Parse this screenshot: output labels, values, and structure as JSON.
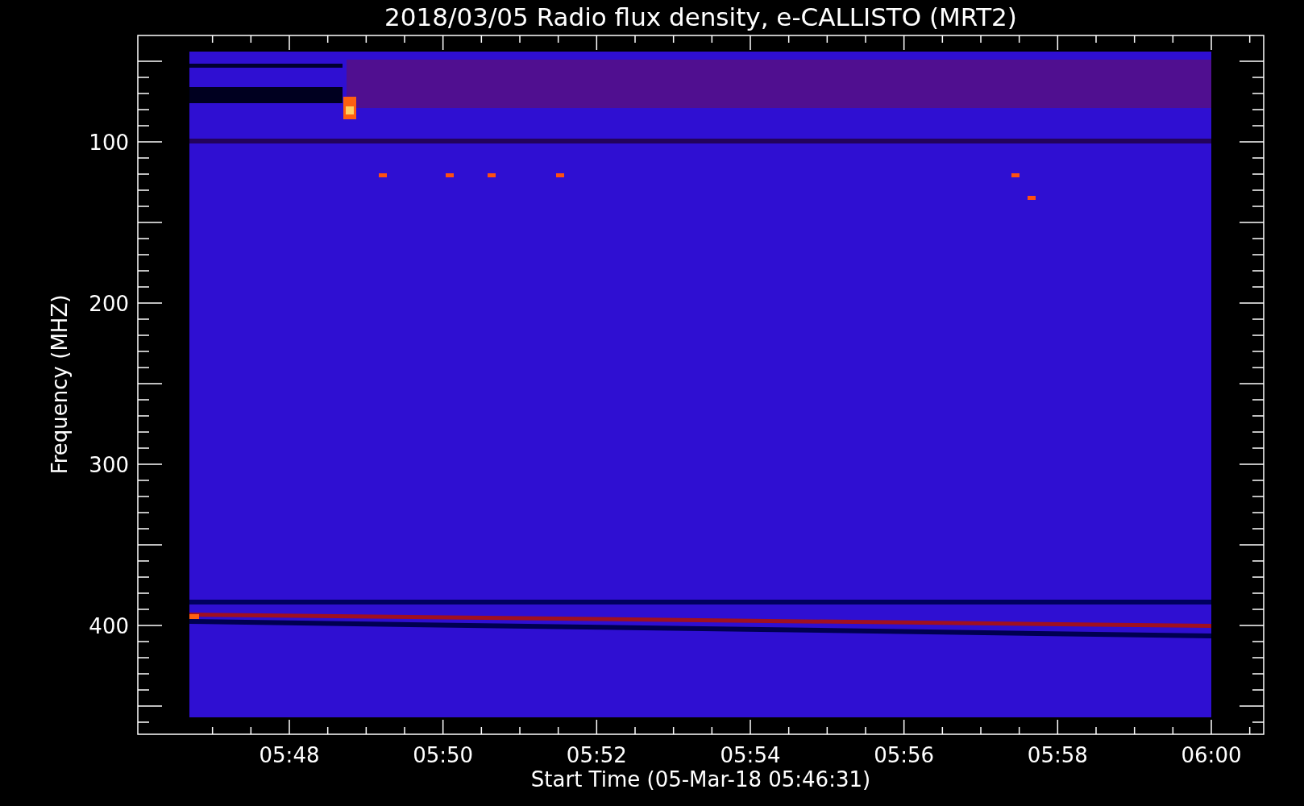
{
  "title": "2018/03/05  Radio flux density, e-CALLISTO (MRT2)",
  "y_axis": {
    "label": "Frequency (MHZ)",
    "ticks": [
      "100",
      "200",
      "300",
      "400"
    ]
  },
  "x_axis": {
    "label": "Start Time (05-Mar-18 05:46:31)",
    "ticks": [
      "05:48",
      "05:50",
      "05:52",
      "05:54",
      "05:56",
      "05:58",
      "06:00"
    ]
  }
}
